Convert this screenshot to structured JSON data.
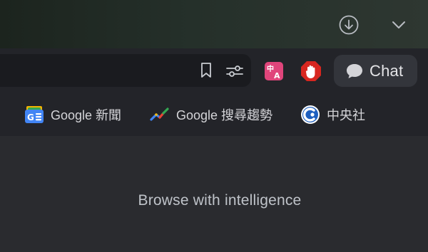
{
  "window": {
    "accent_bg": "#232429",
    "content_bg": "#2a2b2f"
  },
  "titlebar": {
    "icons": [
      "download-icon",
      "chevron-down-icon"
    ]
  },
  "toolbar": {
    "address_value": "",
    "address_icons": [
      "bookmark-icon",
      "sliders-icon"
    ],
    "extensions": [
      {
        "name": "translate-extension",
        "icon": "translate-icon",
        "color": "#e0457b"
      },
      {
        "name": "stop-extension",
        "icon": "stop-hand-icon",
        "color": "#d7261f"
      }
    ],
    "chat_label": "Chat"
  },
  "bookmarks": [
    {
      "label": "Google 新聞",
      "icon": "google-news-icon"
    },
    {
      "label": "Google 搜尋趨勢",
      "icon": "google-trends-icon"
    },
    {
      "label": "中央社",
      "icon": "cna-icon"
    }
  ],
  "content": {
    "tagline": "Browse with intelligence"
  }
}
